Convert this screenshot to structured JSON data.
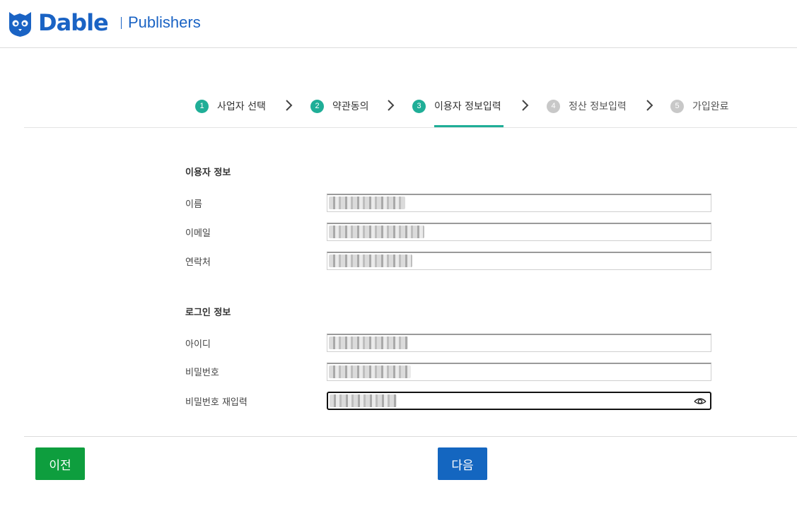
{
  "header": {
    "logo_text": "Dable",
    "logo_subtitle": "Publishers",
    "brand_color": "#1a63c4"
  },
  "steps": [
    {
      "number": "1",
      "label": "사업자 선택",
      "status": "done"
    },
    {
      "number": "2",
      "label": "약관동의",
      "status": "done"
    },
    {
      "number": "3",
      "label": "이용자 정보입력",
      "status": "active"
    },
    {
      "number": "4",
      "label": "정산 정보입력",
      "status": "todo"
    },
    {
      "number": "5",
      "label": "가입완료",
      "status": "todo"
    }
  ],
  "user_info": {
    "title": "이용자 정보",
    "name_label": "이름",
    "email_label": "이메일",
    "phone_label": "연락처"
  },
  "login_info": {
    "title": "로그인 정보",
    "id_label": "아이디",
    "password_label": "비밀번호",
    "password_confirm_label": "비밀번호 재입력"
  },
  "buttons": {
    "prev": "이전",
    "next": "다음"
  },
  "colors": {
    "step_active": "#1fae97",
    "step_inactive": "#c8c8c8",
    "prev_button": "#0e9e3e",
    "next_button": "#1466c0"
  }
}
